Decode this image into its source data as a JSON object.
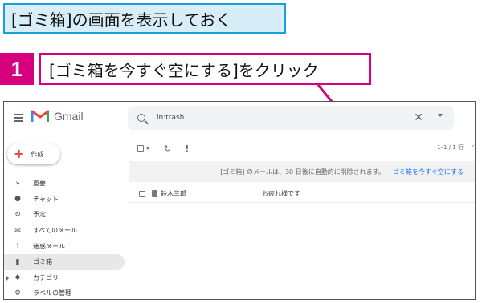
{
  "banner": {
    "text": "[ゴミ箱]の画面を表示しておく"
  },
  "step": {
    "number": "1",
    "instruction": "[ゴミ箱を今すぐ空にする]をクリック"
  },
  "gmail": {
    "logo_text": "Gmail",
    "search_value": "in:trash",
    "compose_label": "作成",
    "nav": [
      {
        "icon": "important-icon",
        "glyph": "»",
        "label": "重要"
      },
      {
        "icon": "chat-icon",
        "glyph": "●",
        "label": "チャット"
      },
      {
        "icon": "scheduled-icon",
        "glyph": "↻",
        "label": "予定"
      },
      {
        "icon": "all-mail-icon",
        "glyph": "✉",
        "label": "すべてのメール"
      },
      {
        "icon": "spam-icon",
        "glyph": "!",
        "label": "迷惑メール"
      },
      {
        "icon": "trash-icon",
        "glyph": "▮",
        "label": "ゴミ箱"
      },
      {
        "icon": "categories-icon",
        "glyph": "◆",
        "label": "カテゴリ"
      },
      {
        "icon": "manage-labels-icon",
        "glyph": "⚙",
        "label": "ラベルの管理"
      }
    ],
    "pager": "1–1 / 1 行",
    "notice_message": "[ゴミ箱] のメールは、30 日後に自動的に削除されます。",
    "notice_link": "ゴミ箱を今すぐ空にする",
    "email_row": {
      "sender": "鈴木三郎",
      "subject": "お疲れ様です"
    },
    "colors": {
      "accent": "#d6007f",
      "banner_border": "#1aa0d8",
      "link": "#1a73e8"
    }
  }
}
